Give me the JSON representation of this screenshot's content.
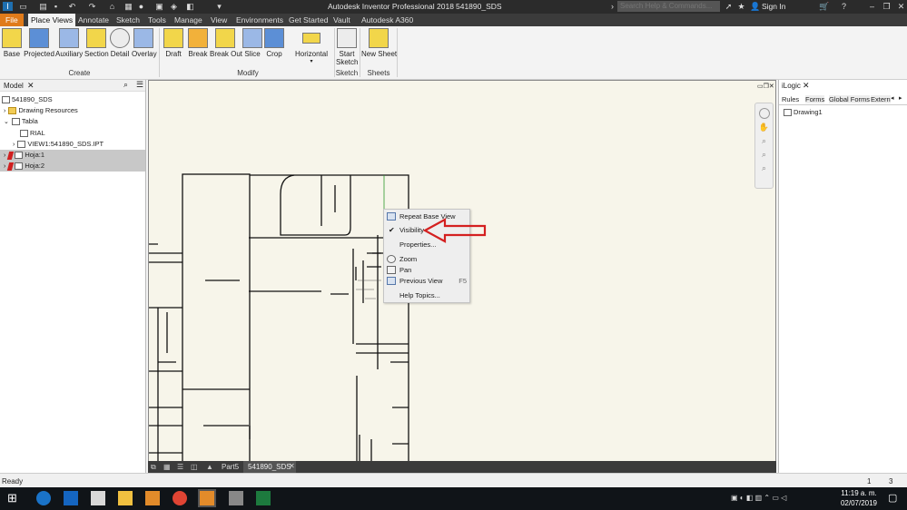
{
  "app": {
    "title": "Autodesk Inventor Professional 2018",
    "document": "541890_SDS",
    "search_placeholder": "Search Help & Commands...",
    "sign_in": "Sign In"
  },
  "menu_tabs": [
    "File",
    "Place Views",
    "Annotate",
    "Sketch",
    "Tools",
    "Manage",
    "View",
    "Environments",
    "Get Started",
    "Vault",
    "Autodesk A360"
  ],
  "ribbon": {
    "create": {
      "buttons": [
        "Base",
        "Projected",
        "Auxiliary",
        "Section",
        "Detail",
        "Overlay"
      ],
      "label": "Create"
    },
    "modify": {
      "buttons": [
        "Draft",
        "Break",
        "Break Out",
        "Slice",
        "Crop",
        "Horizontal"
      ],
      "label": "Modify"
    },
    "sketch": {
      "buttons": [
        "Start Sketch"
      ],
      "label": "Sketch"
    },
    "sheets": {
      "buttons": [
        "New Sheet"
      ],
      "label": "Sheets"
    }
  },
  "model_panel": {
    "title": "Model",
    "tree": [
      "541890_SDS",
      "Drawing Resources",
      "Tabla",
      "RIAL",
      "VIEW1:541890_SDS.IPT",
      "Hoja:1",
      "Hoja:2"
    ]
  },
  "context_menu": {
    "items": [
      "Repeat Base View",
      "Visibility",
      "Properties...",
      "Zoom",
      "Pan",
      "Previous View",
      "Help Topics..."
    ],
    "shortcut_previous_view": "F5"
  },
  "ilogic_panel": {
    "title": "iLogic",
    "tabs": [
      "Rules",
      "Forms",
      "Global Forms",
      "Extern"
    ],
    "items": [
      "Drawing1"
    ]
  },
  "doc_tabs": [
    "Part5",
    "541890_SDS"
  ],
  "status": {
    "text": "Ready",
    "num1": "1",
    "num2": "3"
  },
  "taskbar": {
    "time": "11:19 a. m.",
    "date": "02/07/2019"
  },
  "colors": {
    "file_tab": "#e07b1a",
    "arrow": "#d42020",
    "canvas": "#f7f5ea"
  }
}
